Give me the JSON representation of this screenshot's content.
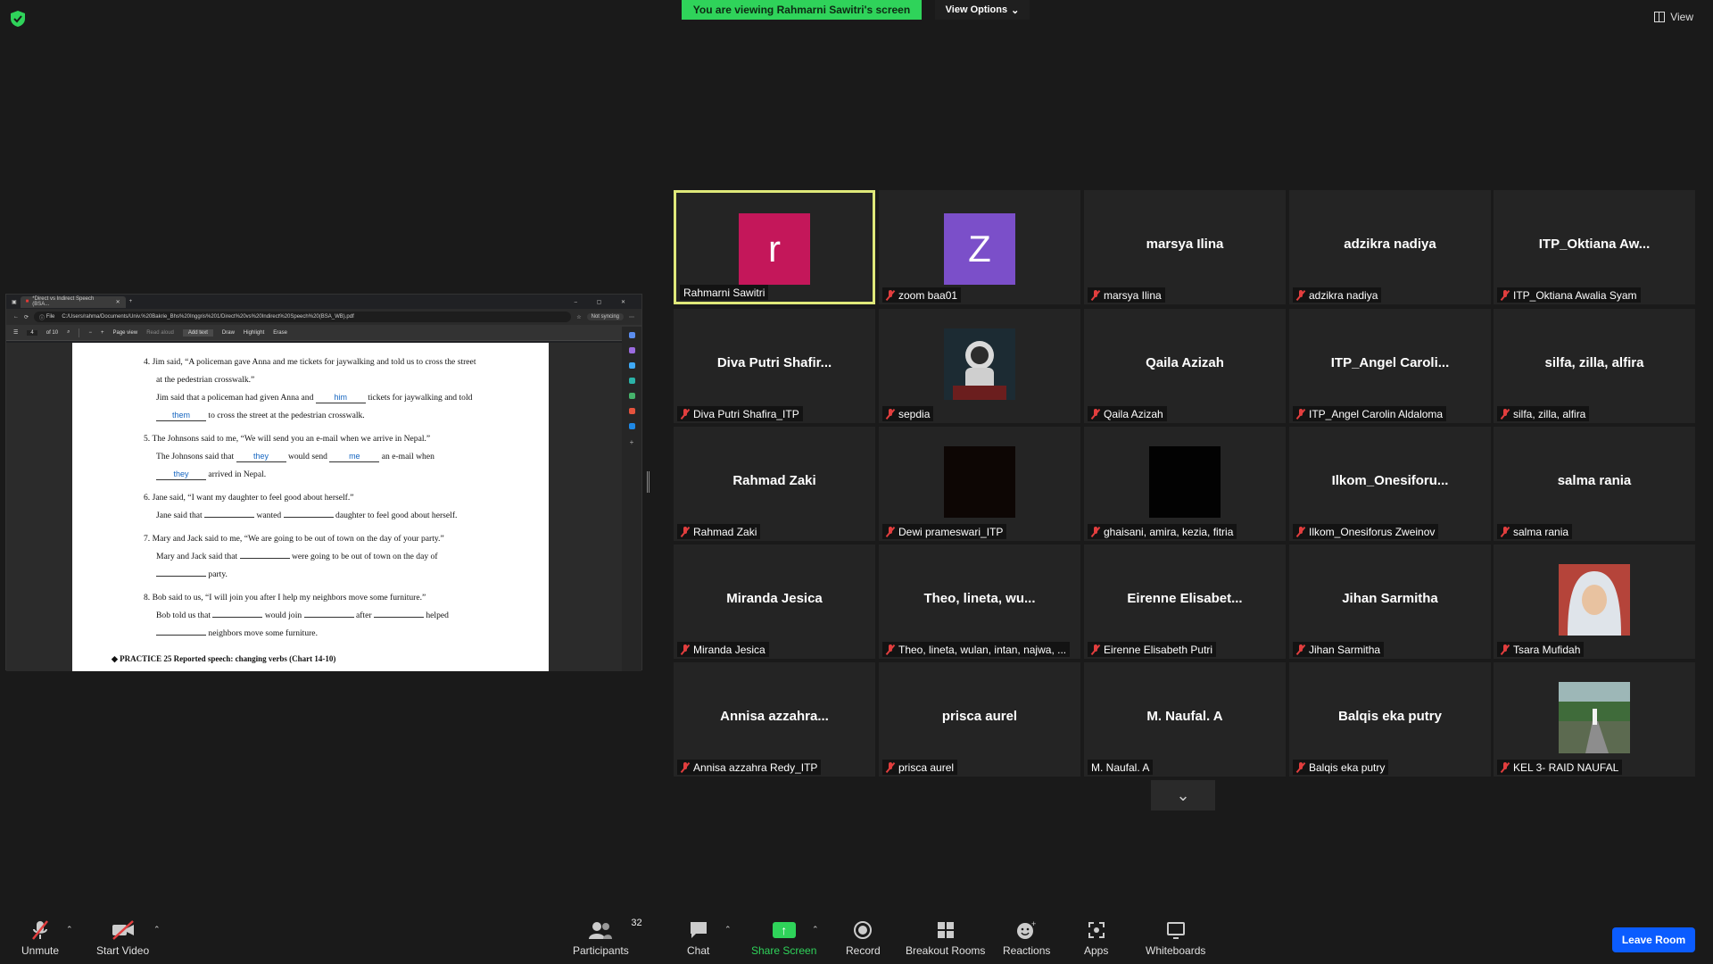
{
  "banner": {
    "viewing": "You are viewing Rahmarni Sawitri's screen",
    "view_options": "View Options",
    "view": "View"
  },
  "browser": {
    "tab_title": "*Direct vs Indirect Speech (BSA...",
    "file_label": "File",
    "url": "C:/Users/rahma/Documents/Univ.%20Bakrie_Bhs%20Inggris%201/Direct%20vs%20Indirect%20Speech%20(BSA_WB).pdf",
    "not_syncing": "Not syncing",
    "page_current": "4",
    "page_total": "of 10",
    "tools": [
      "Page view",
      "Read aloud",
      "Add text",
      "Draw",
      "Highlight",
      "Erase"
    ]
  },
  "pdf": {
    "q4": {
      "num": "4.",
      "prompt": "Jim said, “A policeman gave Anna and me tickets for jaywalking and told us to cross the street",
      "prompt2": "at the pedestrian crosswalk.”",
      "a1": "Jim said that a policeman had given Anna and",
      "b1": "him",
      "a2": "tickets for jaywalking and told",
      "b2": "them",
      "a3": "to cross the street at the pedestrian crosswalk."
    },
    "q5": {
      "num": "5.",
      "prompt": "The Johnsons said to me, “We will send you an e-mail when we arrive in Nepal.”",
      "a1": "The Johnsons said that",
      "b1": "they",
      "a2": "would send",
      "b2": "me",
      "a3": "an e-mail when",
      "b3": "they",
      "a4": "arrived in Nepal."
    },
    "q6": {
      "num": "6.",
      "prompt": "Jane said, “I want my daughter to feel good about herself.”",
      "a1": "Jane said that",
      "a2": "wanted",
      "a3": "daughter to feel good about herself."
    },
    "q7": {
      "num": "7.",
      "prompt": "Mary  and Jack said to me, “We are going to be out of town on the day of your party.”",
      "a1": "Mary and Jack said that",
      "a2": "were going to be out of town on the day of",
      "a3": "party."
    },
    "q8": {
      "num": "8.",
      "prompt": "Bob said to us, “I will join you after I help my neighbors move some furniture.”",
      "a1": "Bob told us that",
      "a2": "would join",
      "a3": "after",
      "a4": "helped",
      "a5": "neighbors move some furniture."
    },
    "next_heading": "◆ PRACTICE 25   Reported speech: changing verbs   (Chart 14-10)"
  },
  "participants": [
    {
      "display": "",
      "label": "Rahmarni Sawitri",
      "avatar": "r",
      "avatar_color": "#c4175a",
      "muted": false,
      "active": true
    },
    {
      "display": "",
      "label": "zoom baa01",
      "avatar": "Z",
      "avatar_color": "#7b4fc9",
      "muted": true
    },
    {
      "display": "marsya Ilina",
      "label": "marsya Ilina",
      "muted": true
    },
    {
      "display": "adzikra nadiya",
      "label": "adzikra nadiya",
      "muted": true
    },
    {
      "display": "ITP_Oktiana  Aw...",
      "label": "ITP_Oktiana Awalia Syam",
      "muted": true
    },
    {
      "display": "Diva  Putri  Shafir...",
      "label": "Diva Putri Shafira_ITP",
      "muted": true
    },
    {
      "display": "",
      "label": "sepdia",
      "thumb": "astronaut",
      "muted": true
    },
    {
      "display": "Qaila Azizah",
      "label": "Qaila Azizah",
      "muted": true
    },
    {
      "display": "ITP_Angel  Caroli...",
      "label": "ITP_Angel Carolin Aldaloma",
      "muted": true
    },
    {
      "display": "silfa, zilla, alfira",
      "label": "silfa, zilla, alfira",
      "muted": true
    },
    {
      "display": "Rahmad Zaki",
      "label": "Rahmad Zaki",
      "muted": true
    },
    {
      "display": "",
      "label": "Dewi prameswari_ITP",
      "thumb": "dark-video",
      "muted": true
    },
    {
      "display": "",
      "label": "ghaisani, amira, kezia, fitria",
      "thumb": "black-video",
      "muted": true
    },
    {
      "display": "Ilkom_Onesiforu...",
      "label": "Ilkom_Onesiforus Zweinov",
      "muted": true
    },
    {
      "display": "salma rania",
      "label": "salma rania",
      "muted": true
    },
    {
      "display": "Miranda Jesica",
      "label": "Miranda Jesica",
      "muted": true
    },
    {
      "display": "Theo,  lineta,  wu...",
      "label": "Theo, lineta, wulan, intan, najwa, ...",
      "muted": true
    },
    {
      "display": "Eirenne  Elisabet...",
      "label": "Eirenne Elisabeth Putri",
      "muted": true
    },
    {
      "display": "Jihan Sarmitha",
      "label": "Jihan Sarmitha",
      "muted": true
    },
    {
      "display": "",
      "label": "Tsara Mufidah",
      "thumb": "hijab-photo",
      "muted": true
    },
    {
      "display": "Annisa  azzahra...",
      "label": "Annisa azzahra Redy_ITP",
      "muted": true
    },
    {
      "display": "prisca aurel",
      "label": "prisca aurel",
      "muted": true
    },
    {
      "display": "M. Naufal. A",
      "label": "M. Naufal. A",
      "muted": false
    },
    {
      "display": "Balqis eka putry",
      "label": "Balqis eka putry",
      "muted": true
    },
    {
      "display": "",
      "label": "KEL 3- RAID NAUFAL",
      "thumb": "road-photo",
      "muted": true
    }
  ],
  "toolbar": {
    "unmute": "Unmute",
    "start_video": "Start Video",
    "participants": "Participants",
    "participants_count": "32",
    "chat": "Chat",
    "share_screen": "Share Screen",
    "record": "Record",
    "breakout_rooms": "Breakout Rooms",
    "reactions": "Reactions",
    "apps": "Apps",
    "whiteboards": "Whiteboards",
    "leave": "Leave Room"
  },
  "colors": {
    "share_green": "#2fd35a",
    "leave_blue": "#0b5cff",
    "active_border": "#dfe87a",
    "muted_red": "#e23e3e"
  }
}
